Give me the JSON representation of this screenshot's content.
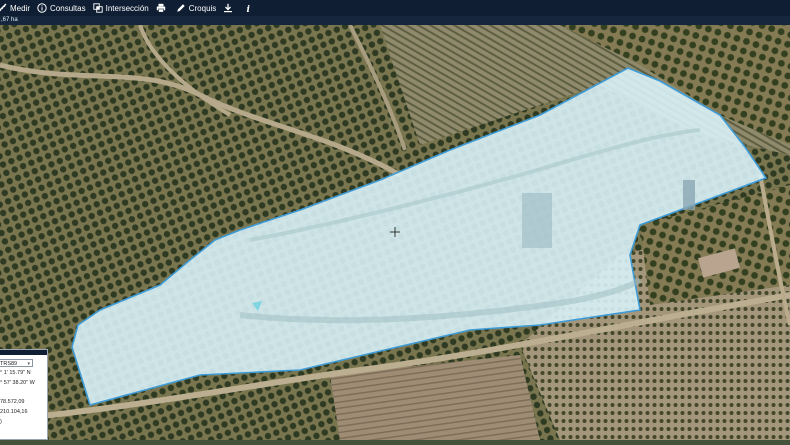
{
  "toolbar": {
    "tools": [
      {
        "label": "Medir",
        "icon": "ruler-icon"
      },
      {
        "label": "Consultas",
        "icon": "info-circle-icon"
      },
      {
        "label": "Intersección",
        "icon": "intersection-icon"
      },
      {
        "label": "",
        "icon": "print-icon"
      },
      {
        "label": "Croquis",
        "icon": "pencil-icon"
      },
      {
        "label": "",
        "icon": "download-icon"
      },
      {
        "label": "",
        "icon": "info-i-icon"
      }
    ]
  },
  "area_readout": ",67 ha",
  "coord_panel": {
    "crs": "TRS89",
    "lat": "° 1' 15.79\" N",
    "lon": "° 57' 38.20\" W",
    "x": "78.572,09",
    "y": "210.104,16",
    "extra": ")"
  },
  "colors": {
    "toolbar_bg": "#0f1e33",
    "polygon_fill": "#d8f1f7",
    "polygon_stroke": "#3e9bd6"
  }
}
